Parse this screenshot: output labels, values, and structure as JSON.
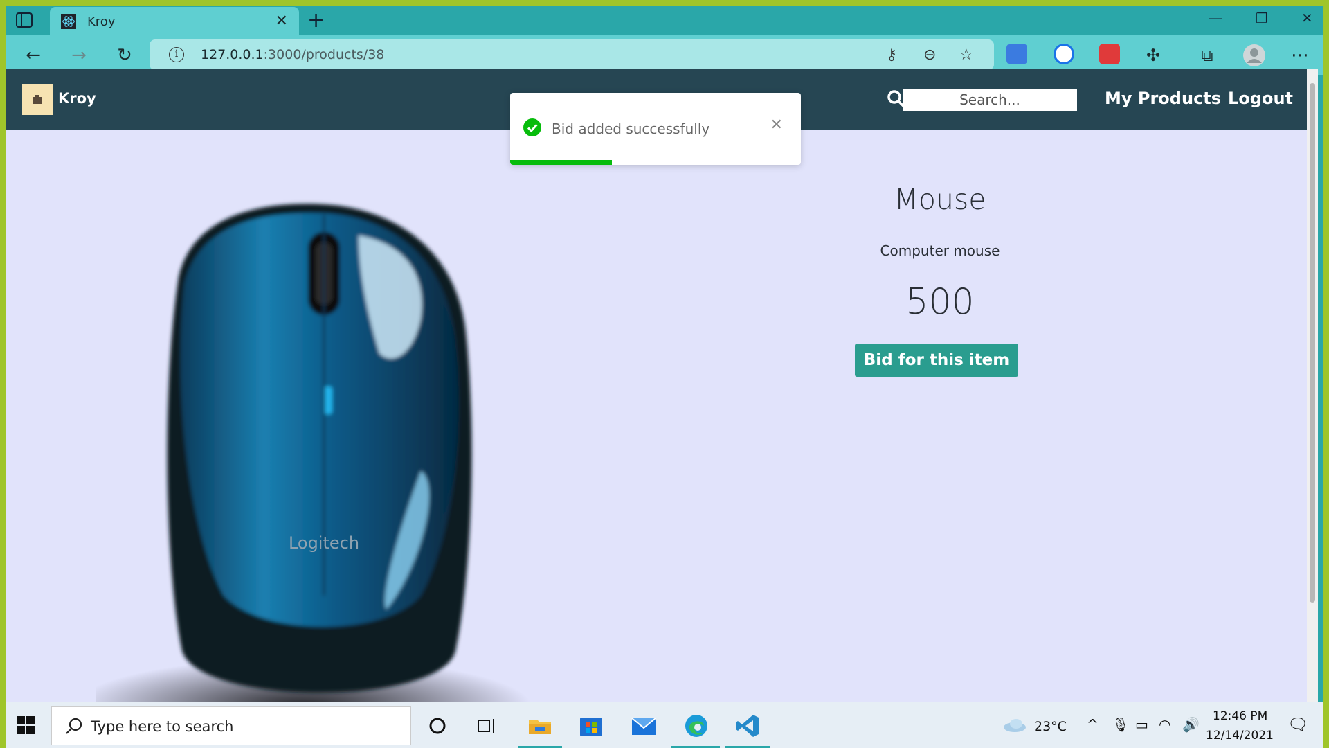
{
  "browser": {
    "tab_title": "Kroy",
    "url_host": "127.0.0.1",
    "url_rest": ":3000/products/38"
  },
  "navbar": {
    "brand": "Kroy",
    "search_placeholder": "Search...",
    "links": [
      "My Products",
      "Logout"
    ]
  },
  "toast": {
    "message": "Bid added successfully",
    "progress": 0.35,
    "color": "#07bc0c"
  },
  "product": {
    "name": "Mouse",
    "description": "Computer mouse",
    "price": "500",
    "bid_label": "Bid for this item",
    "brand_mark": "Logitech"
  },
  "taskbar": {
    "search_placeholder": "Type here to search",
    "temperature": "23°C",
    "time": "12:46 PM",
    "date": "12/14/2021"
  },
  "colors": {
    "navbar": "#264653",
    "accent": "#2a9d8f",
    "page_bg": "#e1e3fb"
  }
}
